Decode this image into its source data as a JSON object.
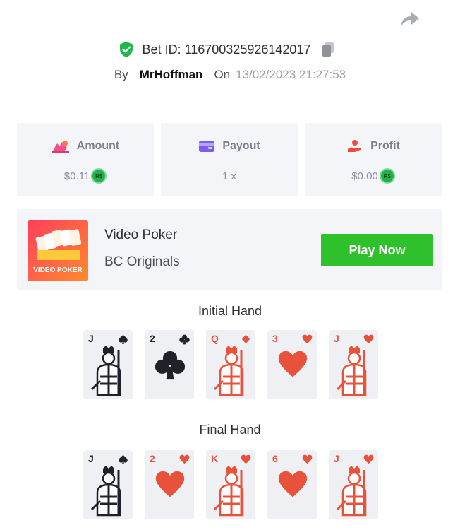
{
  "header": {
    "bet_label": "Bet ID: 116700325926142017",
    "by_label": "By",
    "username": "MrHoffman",
    "on_label": "On",
    "datetime": "13/02/2023 21:27:53"
  },
  "stats": [
    {
      "label": "Amount",
      "value": "$0.11",
      "coin": "R$",
      "icon": "amount-icon"
    },
    {
      "label": "Payout",
      "value": "1 x",
      "icon": "wallet-icon"
    },
    {
      "label": "Profit",
      "value": "$0.00",
      "coin": "R$",
      "icon": "profit-icon"
    }
  ],
  "game": {
    "name": "Video Poker",
    "provider": "BC Originals",
    "thumb_text": "VIDEO POKER",
    "play_label": "Play Now"
  },
  "initial_hand": {
    "title": "Initial Hand",
    "cards": [
      {
        "rank": "J",
        "suit": "spade",
        "color": "black"
      },
      {
        "rank": "2",
        "suit": "club",
        "color": "black"
      },
      {
        "rank": "Q",
        "suit": "diamond",
        "color": "red"
      },
      {
        "rank": "3",
        "suit": "heart",
        "color": "red"
      },
      {
        "rank": "J",
        "suit": "heart",
        "color": "red"
      }
    ]
  },
  "final_hand": {
    "title": "Final Hand",
    "cards": [
      {
        "rank": "J",
        "suit": "spade",
        "color": "black"
      },
      {
        "rank": "2",
        "suit": "heart",
        "color": "red"
      },
      {
        "rank": "K",
        "suit": "heart",
        "color": "red"
      },
      {
        "rank": "6",
        "suit": "heart",
        "color": "red"
      },
      {
        "rank": "J",
        "suit": "heart",
        "color": "red"
      }
    ]
  },
  "colors": {
    "accent_green": "#2fc12b",
    "card_red": "#e8513a",
    "card_black": "#1f2329",
    "panel_bg": "#f4f5f8"
  }
}
